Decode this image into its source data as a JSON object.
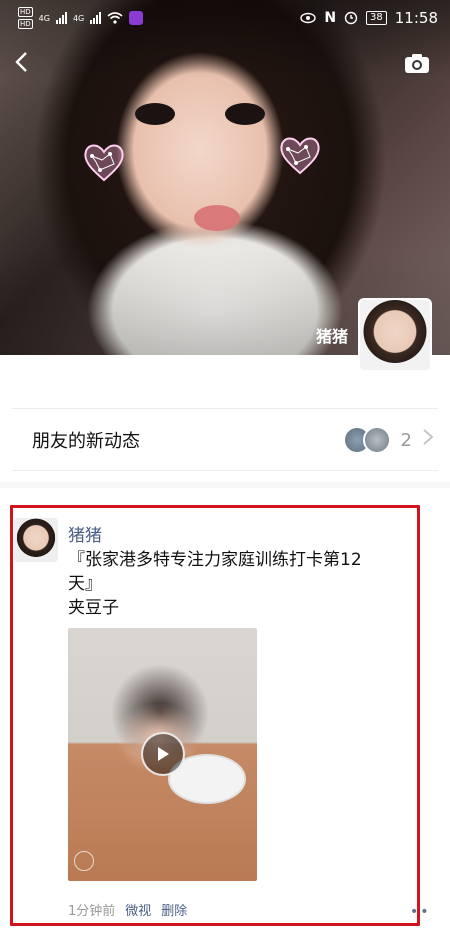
{
  "status_bar": {
    "network_left_top": "HD",
    "network_left_bottom": "HD",
    "network_type_1": "4G",
    "network_type_2": "4G",
    "battery": "38",
    "time": "11:58"
  },
  "profile": {
    "name": "猪猪"
  },
  "friend_updates": {
    "label": "朋友的新动态",
    "count": "2"
  },
  "post": {
    "author": "猪猪",
    "text": "『张家港多特专注力家庭训练打卡第12\n天』\n夹豆子",
    "time": "1分钟前",
    "source": "微视",
    "delete_label": "删除"
  },
  "icons": {
    "back": "back-arrow-icon",
    "camera": "camera-icon",
    "chevron": "chevron-right-icon",
    "play": "play-icon",
    "more": "more-dots-icon"
  },
  "colors": {
    "highlight_border": "#d1141b",
    "author_name": "#4b5f86"
  }
}
